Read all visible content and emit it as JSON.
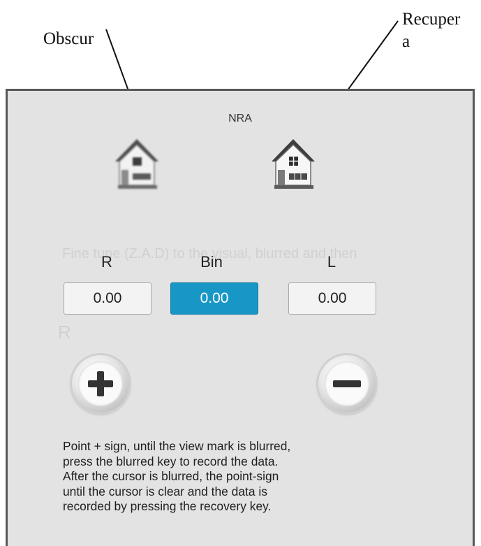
{
  "callouts": {
    "left_label": "Obscur",
    "right_label_line1": "Recuper",
    "right_label_line2": "a"
  },
  "dialog": {
    "title": "NRA",
    "background_text": "Fine tune (Z.A.D) to the visual, blurred and then",
    "background_r_label": "R",
    "buttons": {
      "blur_icon": "house-icon",
      "recover_icon": "house-icon"
    },
    "columns": [
      {
        "label": "R",
        "value": "0.00"
      },
      {
        "label": "Bin",
        "value": "0.00",
        "selected": true
      },
      {
        "label": "L",
        "value": "0.00"
      }
    ],
    "plus_icon": "plus-icon",
    "minus_icon": "minus-icon",
    "instructions": [
      "Point + sign, until the view mark is blurred,",
      "press the blurred key to record the data.",
      "After the cursor is blurred, the point-sign",
      "until the cursor is clear and the data is",
      "recorded by pressing the recovery key."
    ]
  },
  "colors": {
    "selected_value_bg": "#1897c6",
    "panel_bg": "#e3e3e3"
  }
}
